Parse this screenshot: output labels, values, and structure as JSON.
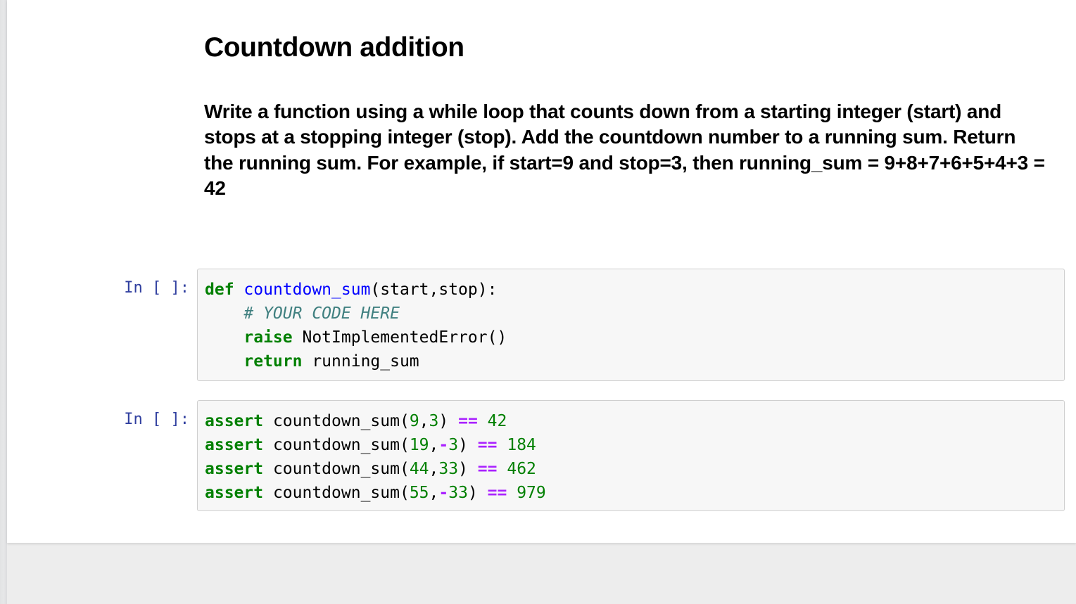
{
  "notebook": {
    "title": "Countdown addition",
    "problem_statement": "Write a function using a while loop that counts down from a starting integer (start) and stops at a stopping integer (stop). Add the countdown number to a running sum. Return the running sum. For example, if start=9 and stop=3, then running_sum = 9+8+7+6+5+4+3 = 42",
    "cells": [
      {
        "prompt": "In [ ]:",
        "lines": [
          [
            {
              "t": "def",
              "c": "kw"
            },
            {
              "t": " ",
              "c": "plain"
            },
            {
              "t": "countdown_sum",
              "c": "fname"
            },
            {
              "t": "(start,stop):",
              "c": "plain"
            }
          ],
          [
            {
              "t": "    ",
              "c": "plain"
            },
            {
              "t": "# YOUR CODE HERE",
              "c": "comment"
            }
          ],
          [
            {
              "t": "    ",
              "c": "plain"
            },
            {
              "t": "raise",
              "c": "kw"
            },
            {
              "t": " NotImplementedError()",
              "c": "plain"
            }
          ],
          [
            {
              "t": "    ",
              "c": "plain"
            },
            {
              "t": "return",
              "c": "kw"
            },
            {
              "t": " running_sum",
              "c": "plain"
            }
          ]
        ]
      },
      {
        "prompt": "In [ ]:",
        "lines": [
          [
            {
              "t": "assert",
              "c": "kw"
            },
            {
              "t": " countdown_sum(",
              "c": "plain"
            },
            {
              "t": "9",
              "c": "num"
            },
            {
              "t": ",",
              "c": "plain"
            },
            {
              "t": "3",
              "c": "num"
            },
            {
              "t": ") ",
              "c": "plain"
            },
            {
              "t": "==",
              "c": "op"
            },
            {
              "t": " ",
              "c": "plain"
            },
            {
              "t": "42",
              "c": "num"
            }
          ],
          [
            {
              "t": "assert",
              "c": "kw"
            },
            {
              "t": " countdown_sum(",
              "c": "plain"
            },
            {
              "t": "19",
              "c": "num"
            },
            {
              "t": ",",
              "c": "plain"
            },
            {
              "t": "-",
              "c": "op"
            },
            {
              "t": "3",
              "c": "num"
            },
            {
              "t": ") ",
              "c": "plain"
            },
            {
              "t": "==",
              "c": "op"
            },
            {
              "t": " ",
              "c": "plain"
            },
            {
              "t": "184",
              "c": "num"
            }
          ],
          [
            {
              "t": "assert",
              "c": "kw"
            },
            {
              "t": " countdown_sum(",
              "c": "plain"
            },
            {
              "t": "44",
              "c": "num"
            },
            {
              "t": ",",
              "c": "plain"
            },
            {
              "t": "33",
              "c": "num"
            },
            {
              "t": ") ",
              "c": "plain"
            },
            {
              "t": "==",
              "c": "op"
            },
            {
              "t": " ",
              "c": "plain"
            },
            {
              "t": "462",
              "c": "num"
            }
          ],
          [
            {
              "t": "assert",
              "c": "kw"
            },
            {
              "t": " countdown_sum(",
              "c": "plain"
            },
            {
              "t": "55",
              "c": "num"
            },
            {
              "t": ",",
              "c": "plain"
            },
            {
              "t": "-",
              "c": "op"
            },
            {
              "t": "33",
              "c": "num"
            },
            {
              "t": ") ",
              "c": "plain"
            },
            {
              "t": "==",
              "c": "op"
            },
            {
              "t": " ",
              "c": "plain"
            },
            {
              "t": "979",
              "c": "num"
            }
          ]
        ]
      }
    ]
  },
  "colors": {
    "page_background": "#ffffff",
    "app_background": "#ededed",
    "prompt": "#303f9f",
    "cell_background": "#f7f7f7",
    "cell_border": "#cfcfcf",
    "keyword": "#008000",
    "function_name": "#0000ff",
    "comment": "#408080",
    "number": "#008000",
    "operator": "#aa22ff"
  }
}
